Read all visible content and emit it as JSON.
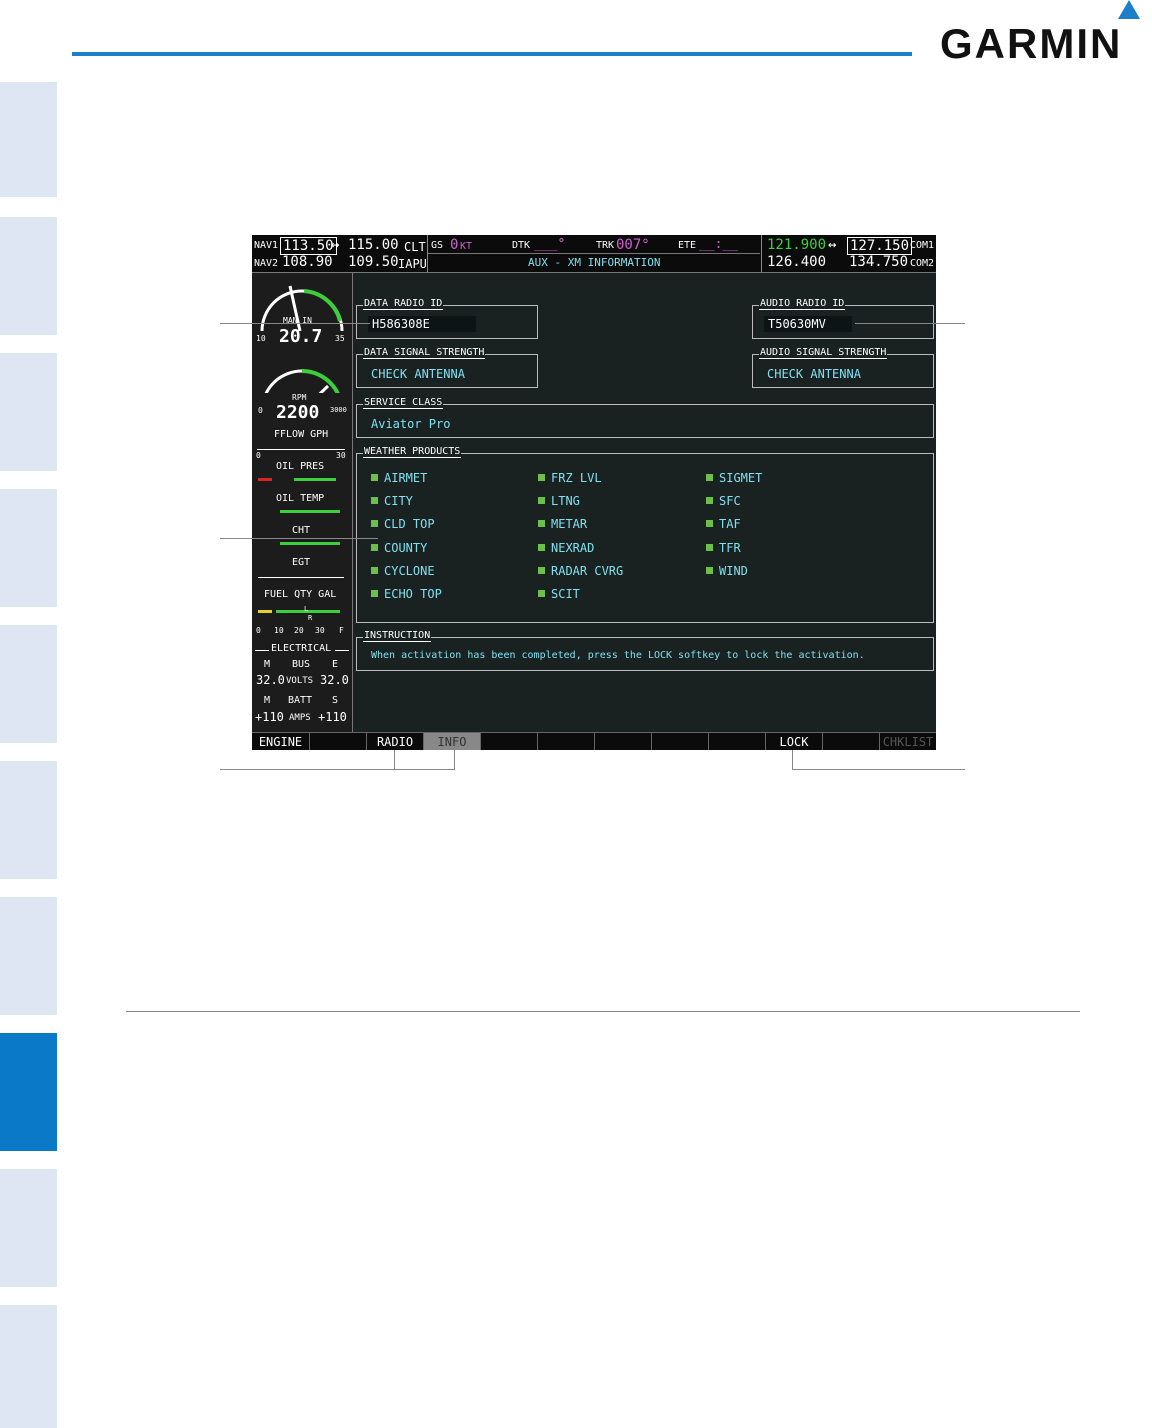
{
  "brand": {
    "logo_text": "GARMIN"
  },
  "top_bar": {
    "nav1_label": "NAV1",
    "nav1_active": "113.50",
    "nav1_standby": "115.00",
    "nav1_id": "CLT",
    "nav2_label": "NAV2",
    "nav2_active": "108.90",
    "nav2_standby": "109.50",
    "nav2_id": "IAPU",
    "swap_arrow": "↔",
    "gs_label": "GS",
    "gs_value": "0",
    "gs_unit": "KT",
    "dtk_label": "DTK",
    "dtk_value": "___°",
    "trk_label": "TRK",
    "trk_value": "007°",
    "ete_label": "ETE",
    "ete_value": "__:__",
    "page_title": "AUX - XM INFORMATION",
    "com1_active": "121.900",
    "com1_standby": "127.150",
    "com1_label": "COM1",
    "com2_active": "126.400",
    "com2_standby": "134.750",
    "com2_label": "COM2"
  },
  "eis": {
    "man_in_label": "MAN IN",
    "man_in_value": "20.7",
    "man_in_min": "10",
    "man_in_max": "35",
    "rpm_label": "RPM",
    "rpm_value": "2200",
    "rpm_min": "0",
    "rpm_max": "3000",
    "fflow_label": "FFLOW GPH",
    "fflow_min": "0",
    "fflow_max": "30",
    "oil_pres_label": "OIL PRES",
    "oil_temp_label": "OIL TEMP",
    "cht_label": "CHT",
    "egt_label": "EGT",
    "fuel_label": "FUEL QTY GAL",
    "fuel_scale": [
      "0",
      "10",
      "20",
      "30",
      "F"
    ],
    "fuel_left_marker": "L",
    "fuel_right_marker": "R",
    "electrical_label": "ELECTRICAL",
    "bus_m": "M",
    "bus_label": "BUS",
    "bus_e": "E",
    "volts_m": "32.0",
    "volts_label": "VOLTS",
    "volts_e": "32.0",
    "batt_m": "M",
    "batt_label": "BATT",
    "batt_s": "S",
    "amps_m": "+110",
    "amps_label": "AMPS",
    "amps_s": "+110"
  },
  "panels": {
    "data_radio_id_title": "DATA RADIO ID",
    "data_radio_id": "H586308E",
    "audio_radio_id_title": "AUDIO RADIO ID",
    "audio_radio_id": "T50630MV",
    "data_signal_title": "DATA SIGNAL STRENGTH",
    "data_signal_value": "CHECK ANTENNA",
    "audio_signal_title": "AUDIO SIGNAL STRENGTH",
    "audio_signal_value": "CHECK ANTENNA",
    "service_class_title": "SERVICE CLASS",
    "service_class_value": "Aviator Pro",
    "weather_title": "WEATHER PRODUCTS",
    "weather_col1": [
      "AIRMET",
      "CITY",
      "CLD TOP",
      "COUNTY",
      "CYCLONE",
      "ECHO TOP"
    ],
    "weather_col2": [
      "FRZ LVL",
      "LTNG",
      "METAR",
      "NEXRAD",
      "RADAR CVRG",
      "SCIT"
    ],
    "weather_col3": [
      "SIGMET",
      "SFC",
      "TAF",
      "TFR",
      "WIND"
    ],
    "instruction_title": "INSTRUCTION",
    "instruction_text": "When activation has been completed, press the LOCK softkey to lock the activation."
  },
  "softkeys": [
    "ENGINE",
    "",
    "RADIO",
    "INFO",
    "",
    "",
    "",
    "",
    "",
    "LOCK",
    "",
    "CHKLIST"
  ]
}
